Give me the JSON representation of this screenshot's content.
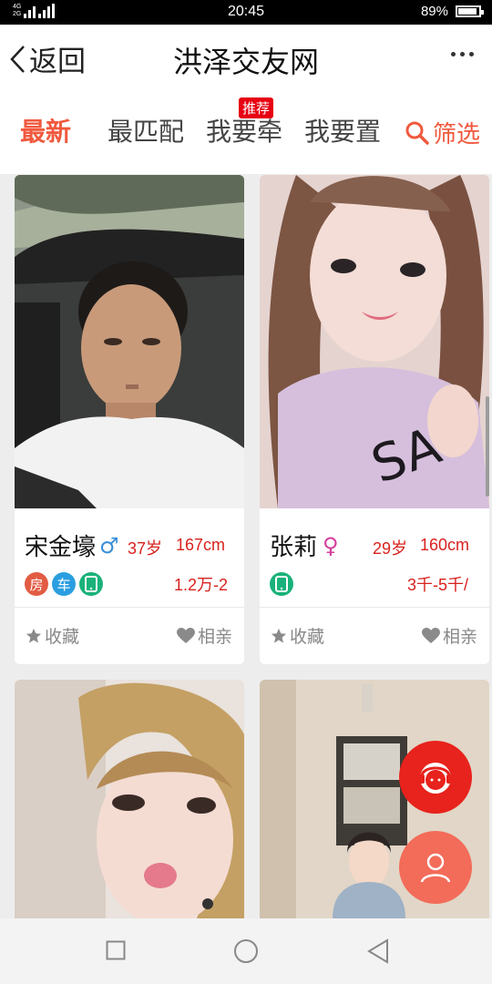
{
  "status_bar": {
    "net_top": "4G",
    "net_bottom": "2G",
    "time": "20:45",
    "battery": "89%",
    "battery_level": 0.89
  },
  "header": {
    "back_label": "返回",
    "title": "洪泽交友网"
  },
  "tabs": {
    "items": [
      "最新",
      "最匹配",
      "我要牵",
      "我要置"
    ],
    "badge": "推荐",
    "filter_label": "筛选"
  },
  "colors": {
    "accent": "#f0593e",
    "price_red": "#d8221d",
    "house": "#e25c44",
    "car": "#2a9ee0",
    "phone": "#1ab27a",
    "male": "#3a8fd6",
    "female": "#d33f9e"
  },
  "cards": [
    {
      "name": "宋金壕",
      "gender": "male",
      "gender_symbol": "♂",
      "age": "37岁",
      "height": "167cm",
      "icons": [
        "房",
        "车"
      ],
      "has_phone": true,
      "income": "1.2万-2",
      "fav": "收藏",
      "like": "相亲"
    },
    {
      "name": "张莉",
      "gender": "female",
      "gender_symbol": "♀",
      "age": "29岁",
      "height": "160cm",
      "icons": [],
      "has_phone": true,
      "income": "3千-5千/",
      "fav": "收藏",
      "like": "相亲"
    }
  ],
  "fabs": [
    {
      "icon": "customer-service-icon"
    },
    {
      "icon": "user-icon"
    }
  ]
}
